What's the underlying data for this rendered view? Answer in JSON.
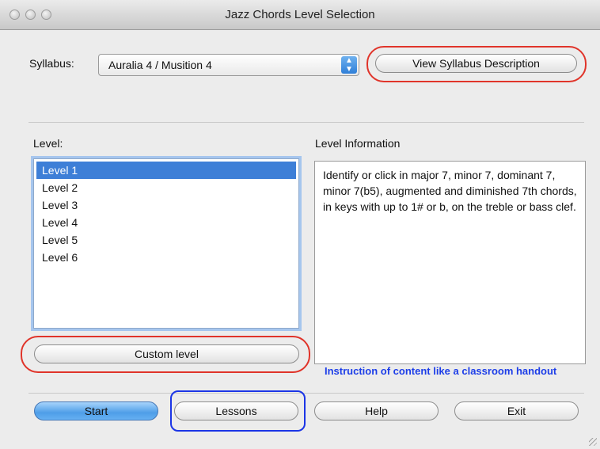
{
  "window": {
    "title": "Jazz Chords Level Selection"
  },
  "syllabus": {
    "label": "Syllabus:",
    "selected": "Auralia 4 / Musition 4",
    "view_button": "View Syllabus Description"
  },
  "level": {
    "label": "Level:",
    "items": [
      "Level 1",
      "Level 2",
      "Level 3",
      "Level 4",
      "Level 5",
      "Level 6"
    ],
    "selected_index": 0,
    "custom_button": "Custom level"
  },
  "info": {
    "label": "Level Information",
    "text": "Identify or click in major 7, minor 7, dominant 7, minor 7(b5), augmented and diminished 7th chords, in keys with up to 1# or b, on the treble or bass clef."
  },
  "annotation": {
    "text": "Instruction of content like a classroom handout"
  },
  "footer": {
    "start": "Start",
    "lessons": "Lessons",
    "help": "Help",
    "exit": "Exit"
  },
  "colors": {
    "annotation_red": "#e0342a",
    "annotation_blue": "#1b35e6",
    "selection": "#3e7fd7"
  }
}
